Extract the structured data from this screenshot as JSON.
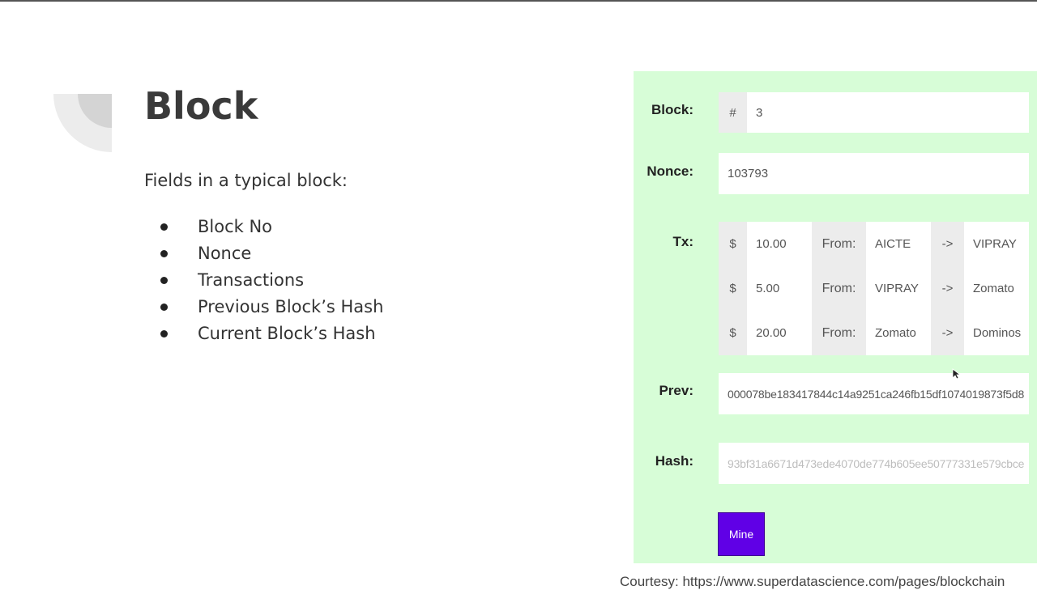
{
  "slide": {
    "title": "Block",
    "intro": "Fields in a typical block:",
    "bullets": [
      "Block No",
      "Nonce",
      "Transactions",
      "Previous Block’s Hash",
      "Current Block’s Hash"
    ],
    "courtesy": "Courtesy: https://www.superdatascience.com/pages/blockchain"
  },
  "block_panel": {
    "background": "#d7fdd7",
    "block_label": "Block:",
    "block_prefix": "#",
    "block_number": "3",
    "nonce_label": "Nonce:",
    "nonce_value": "103793",
    "tx_label": "Tx:",
    "transactions": [
      {
        "currency": "$",
        "amount": "10.00",
        "from_label": "From:",
        "sender": "AICTE",
        "arrow": "->",
        "receiver": "VIPRAY"
      },
      {
        "currency": "$",
        "amount": "5.00",
        "from_label": "From:",
        "sender": "VIPRAY",
        "arrow": "->",
        "receiver": "Zomato"
      },
      {
        "currency": "$",
        "amount": "20.00",
        "from_label": "From:",
        "sender": "Zomato",
        "arrow": "->",
        "receiver": "Dominos"
      }
    ],
    "prev_label": "Prev:",
    "prev_hash": "000078be183417844c14a9251ca246fb15df1074019873f5d8",
    "hash_label": "Hash:",
    "hash_value": "93bf31a6671d473ede4070de774b605ee50777331e579cbce",
    "mine_button": "Mine",
    "mine_color": "#6000e6"
  }
}
